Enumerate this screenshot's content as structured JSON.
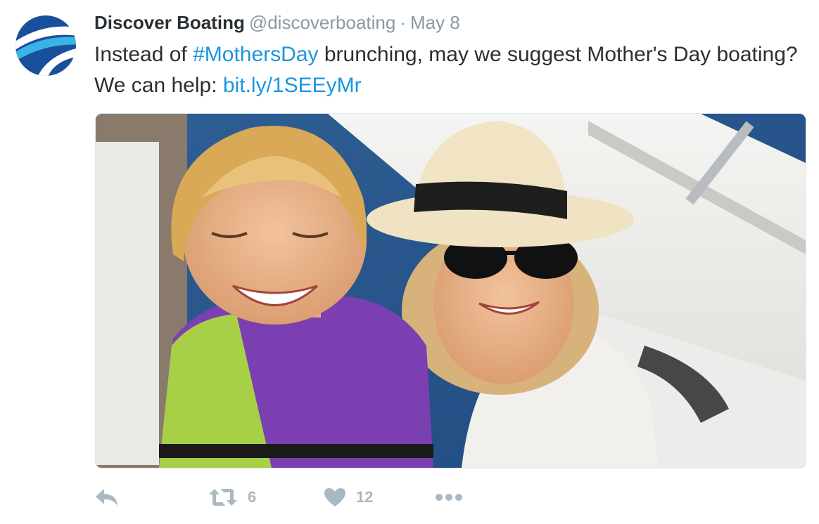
{
  "tweet": {
    "author": {
      "name": "Discover Boating",
      "handle": "@discoverboating",
      "avatar_icon": "discover-boating-logo-icon"
    },
    "separator": "·",
    "date": "May 8",
    "text_part1": "Instead of ",
    "hashtag": "#MothersDay",
    "text_part2": " brunching, may we suggest Mother's Day boating? We can help: ",
    "link": "bit.ly/1SEEyMr",
    "media": {
      "description_icon": "photo-mother-and-son-on-boat"
    },
    "actions": {
      "reply_icon": "reply-icon",
      "retweet_icon": "retweet-icon",
      "retweet_count": "6",
      "like_icon": "heart-icon",
      "like_count": "12",
      "more_icon": "more-icon"
    }
  },
  "colors": {
    "link": "#1b95e0",
    "muted": "#8899a6",
    "action": "#aab8c2",
    "text": "#292f33",
    "logo": "#1c5aa6"
  }
}
